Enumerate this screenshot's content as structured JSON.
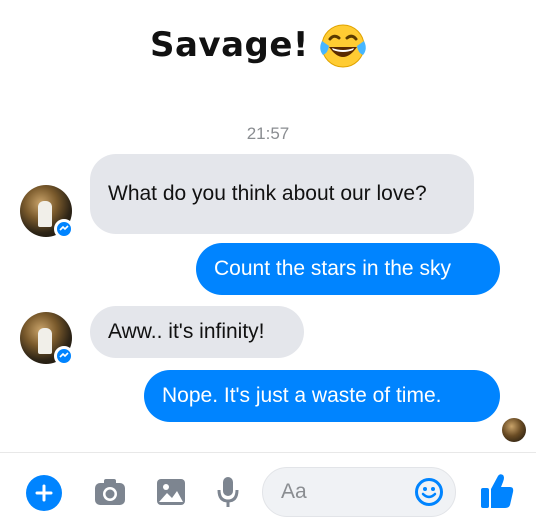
{
  "header": {
    "title": "Savage!",
    "emoji": "laughing-tears-emoji"
  },
  "chat": {
    "timestamp": "21:57",
    "messages": [
      {
        "side": "received",
        "text": "What do you think about our love?"
      },
      {
        "side": "sent",
        "text": "Count the stars in the sky"
      },
      {
        "side": "received",
        "text": "Aww.. it's infinity!"
      },
      {
        "side": "sent",
        "text": "Nope. It's just a waste of time."
      }
    ]
  },
  "composer": {
    "placeholder": "Aa",
    "icons": [
      "plus-icon",
      "camera-icon",
      "image-icon",
      "microphone-icon",
      "emoji-icon",
      "thumbs-up-icon"
    ]
  },
  "colors": {
    "accent": "#0084ff",
    "received_bubble": "#e4e6eb",
    "timestamp": "#8a8d91"
  }
}
